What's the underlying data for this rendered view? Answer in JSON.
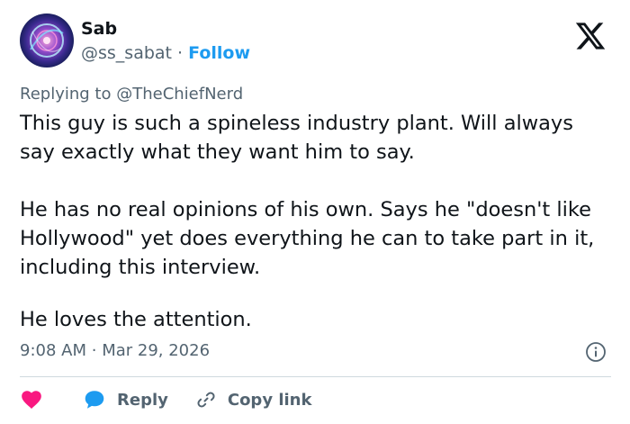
{
  "author": {
    "name": "Sab",
    "handle": "@ss_sabat",
    "separator": "·",
    "follow_label": "Follow"
  },
  "reply_context": {
    "prefix": "Replying to",
    "mention": "@TheChiefNerd"
  },
  "tweet": {
    "paragraph1": "This guy is such a spineless industry plant. Will always say exactly what they want him to say.",
    "paragraph2": "He has no real opinions of his own. Says he \"doesn't like Hollywood\" yet does everything he can to take part in it, including this interview.",
    "paragraph3": "He loves the attention."
  },
  "meta": {
    "time": "9:08 AM",
    "separator": "·",
    "date": "Mar 29, 2026"
  },
  "actions": {
    "reply_label": "Reply",
    "copy_link_label": "Copy link"
  },
  "icons": {
    "brand": "x-logo-icon",
    "info": "info-icon",
    "like": "heart-icon",
    "reply": "speech-bubble-icon",
    "copy": "link-icon"
  },
  "colors": {
    "follow": "#1d9bf0",
    "muted": "#536471",
    "heart": "#f91880",
    "reply": "#1d9bf0",
    "divider": "#cfd9de"
  }
}
